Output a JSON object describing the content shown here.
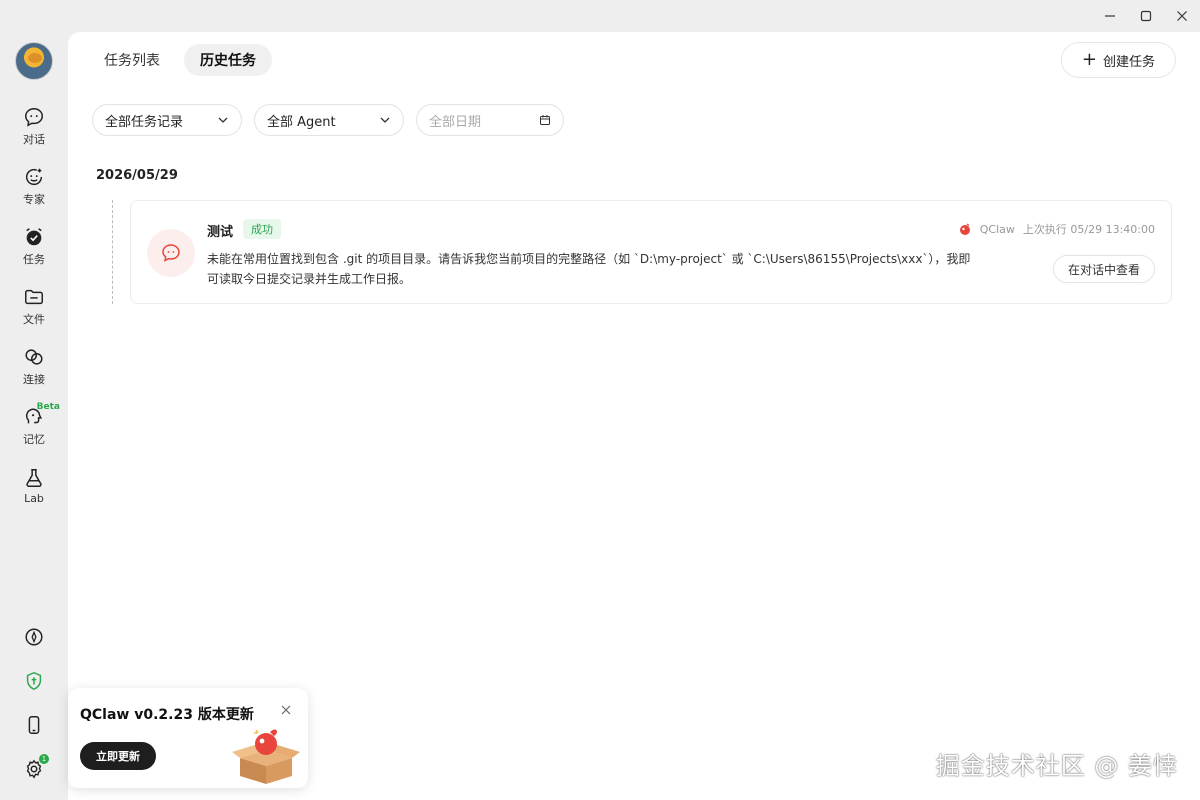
{
  "sidebar": {
    "items": [
      {
        "label": "对话",
        "icon": "chat-icon"
      },
      {
        "label": "专家",
        "icon": "expert-icon"
      },
      {
        "label": "任务",
        "icon": "task-icon"
      },
      {
        "label": "文件",
        "icon": "folder-icon"
      },
      {
        "label": "连接",
        "icon": "link-icon"
      },
      {
        "label": "记忆",
        "icon": "memory-icon",
        "badge": "Beta"
      },
      {
        "label": "Lab",
        "icon": "flask-icon"
      }
    ],
    "bottom_icons": [
      "compass-icon",
      "shield-icon",
      "phone-icon",
      "gear-icon"
    ],
    "settings_badge": "1"
  },
  "header": {
    "tabs": [
      {
        "label": "任务列表",
        "active": false
      },
      {
        "label": "历史任务",
        "active": true
      }
    ],
    "create_button": "创建任务"
  },
  "filters": {
    "task_records": "全部任务记录",
    "agent": "全部 Agent",
    "date_placeholder": "全部日期"
  },
  "groups": [
    {
      "date": "2026/05/29",
      "tasks": [
        {
          "title": "测试",
          "status": "成功",
          "description": "未能在常用位置找到包含 .git 的项目目录。请告诉我您当前项目的完整路径（如 `D:\\my-project` 或 `C:\\Users\\86155\\Projects\\xxx`），我即可读取今日提交记录并生成工作日报。",
          "agent": "QClaw",
          "last_run": "上次执行 05/29 13:40:00",
          "view_button": "在对话中查看"
        }
      ]
    }
  ],
  "toast": {
    "title": "QClaw v0.2.23 版本更新",
    "update_button": "立即更新"
  },
  "watermark": "掘金技术社区 @ 姜悻",
  "colors": {
    "success": "#2aa84a",
    "brand_red": "#e8453c"
  }
}
